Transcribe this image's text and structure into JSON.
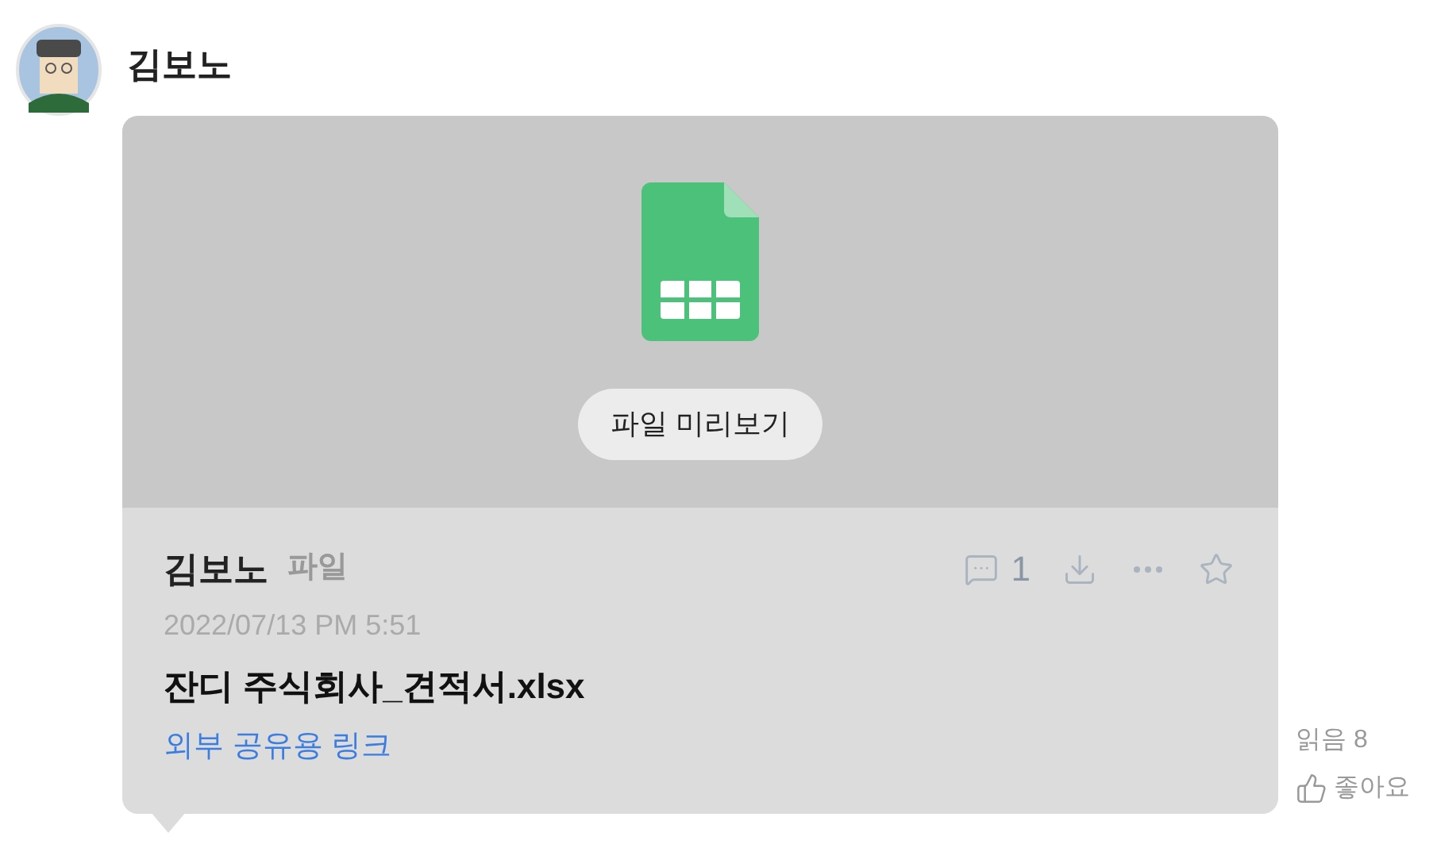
{
  "author": {
    "name": "김보노"
  },
  "card": {
    "preview_button": "파일 미리보기",
    "sender": "김보노",
    "type_label": "파일",
    "comment_count": "1",
    "date": "2022/07/13 PM 5:51",
    "file_name": "잔디 주식회사_견적서.xlsx",
    "link": "외부 공유용 링크"
  },
  "side": {
    "read": "읽음 8",
    "like": "좋아요"
  }
}
